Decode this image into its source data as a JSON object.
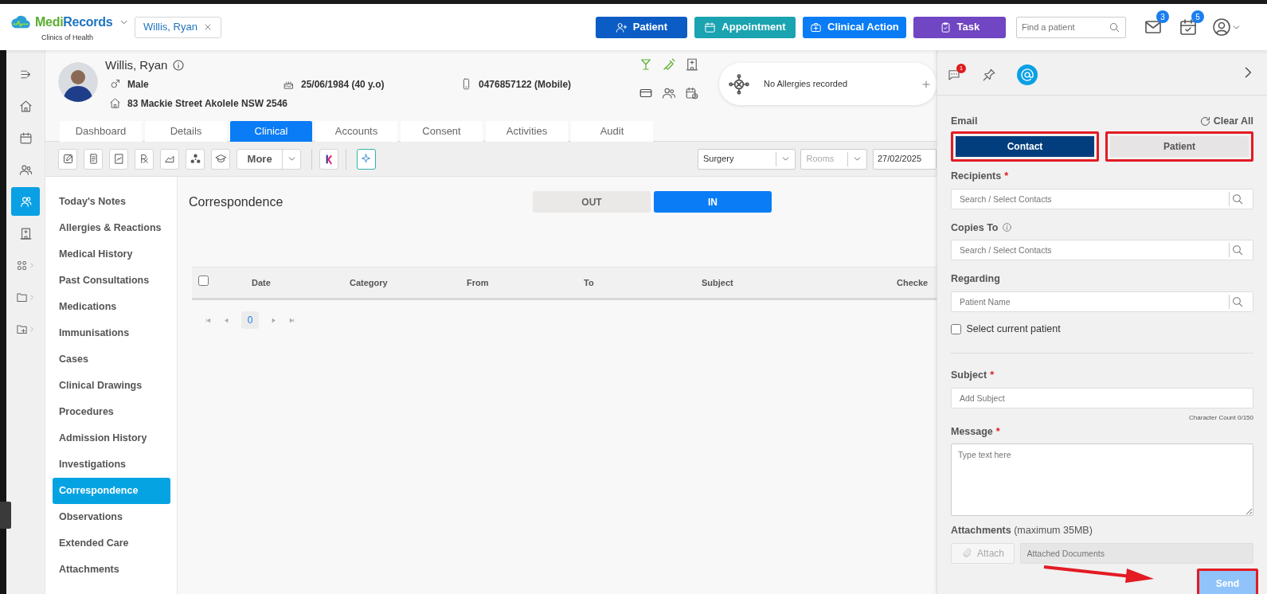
{
  "app": {
    "logo_parts": [
      {
        "text": "Medi",
        "color": "#5aae2e"
      },
      {
        "text": "Records",
        "color": "#1e73be"
      }
    ],
    "clinic": "Clinics of Health"
  },
  "open_patient": {
    "label": "Willis, Ryan"
  },
  "actions": [
    {
      "label": "Patient",
      "kind": "user-plus",
      "color": "#0b5cc4"
    },
    {
      "label": "Appointment",
      "kind": "calendar",
      "color": "#1aa3b0"
    },
    {
      "label": "Clinical Action",
      "kind": "medkit",
      "color": "#0a7cf5"
    },
    {
      "label": "Task",
      "kind": "clipboard",
      "color": "#7046c2"
    }
  ],
  "search": {
    "placeholder": "Find a patient"
  },
  "notifications": [
    {
      "kind": "mail",
      "count": "3"
    },
    {
      "kind": "calendar-check",
      "count": "5"
    }
  ],
  "rail": [
    {
      "kind": "expand",
      "selected": false,
      "submenu": false
    },
    {
      "kind": "home",
      "selected": false,
      "submenu": false
    },
    {
      "kind": "calendar",
      "selected": false,
      "submenu": false
    },
    {
      "kind": "people",
      "selected": false,
      "submenu": false
    },
    {
      "kind": "contacts",
      "selected": true,
      "submenu": false
    },
    {
      "kind": "hospital",
      "selected": false,
      "submenu": false
    },
    {
      "kind": "groups",
      "selected": false,
      "submenu": true
    },
    {
      "kind": "folder",
      "selected": false,
      "submenu": true
    },
    {
      "kind": "folder-plus",
      "selected": false,
      "submenu": true
    }
  ],
  "patient": {
    "name": "Willis, Ryan",
    "gender": "Male",
    "dob": "25/06/1984 (40 y.o)",
    "phone": "0476857122 (Mobile)",
    "address": "83 Mackie Street Akolele NSW 2546"
  },
  "allergies": {
    "text": "No Allergies recorded"
  },
  "tabs": [
    {
      "label": "Dashboard",
      "selected": false
    },
    {
      "label": "Details",
      "selected": false
    },
    {
      "label": "Clinical",
      "selected": true
    },
    {
      "label": "Accounts",
      "selected": false
    },
    {
      "label": "Consent",
      "selected": false
    },
    {
      "label": "Activities",
      "selected": false
    },
    {
      "label": "Audit",
      "selected": false
    }
  ],
  "toolbar": {
    "more": "More",
    "location": "Surgery",
    "rooms_placeholder": "Rooms",
    "date": "27/02/2025"
  },
  "side_menu": [
    {
      "label": "Today's Notes",
      "selected": false
    },
    {
      "label": "Allergies & Reactions",
      "selected": false
    },
    {
      "label": "Medical History",
      "selected": false
    },
    {
      "label": "Past Consultations",
      "selected": false
    },
    {
      "label": "Medications",
      "selected": false
    },
    {
      "label": "Immunisations",
      "selected": false
    },
    {
      "label": "Cases",
      "selected": false
    },
    {
      "label": "Clinical Drawings",
      "selected": false
    },
    {
      "label": "Procedures",
      "selected": false
    },
    {
      "label": "Admission History",
      "selected": false
    },
    {
      "label": "Investigations",
      "selected": false
    },
    {
      "label": "Correspondence",
      "selected": true
    },
    {
      "label": "Observations",
      "selected": false
    },
    {
      "label": "Extended Care",
      "selected": false
    },
    {
      "label": "Attachments",
      "selected": false
    }
  ],
  "content": {
    "title": "Correspondence",
    "direction": [
      {
        "label": "OUT",
        "selected": false
      },
      {
        "label": "IN",
        "selected": true
      }
    ],
    "columns": [
      "Date",
      "Category",
      "From",
      "To",
      "Subject",
      "Checke"
    ],
    "select_all": {
      "checked": false
    },
    "page": "0"
  },
  "panel": {
    "tabs": [
      {
        "kind": "chat",
        "badge": "1",
        "selected": false
      },
      {
        "kind": "pin",
        "selected": false
      },
      {
        "kind": "email",
        "selected": true
      }
    ],
    "section": "Email",
    "clear": "Clear All",
    "modes": [
      {
        "label": "Contact",
        "selected": true,
        "highlighted": true
      },
      {
        "label": "Patient",
        "selected": false,
        "highlighted": true
      }
    ],
    "fields": [
      {
        "label": "Recipients",
        "required_mark": "*",
        "info": false,
        "placeholder": "Search / Select Contacts"
      },
      {
        "label": "Copies To",
        "info": true,
        "placeholder": "Search / Select Contacts"
      },
      {
        "label": "Regarding",
        "info": false,
        "placeholder": "Patient Name"
      }
    ],
    "current_patient": {
      "label": "Select current patient",
      "checked": false
    },
    "subject": {
      "label": "Subject",
      "required_mark": "*",
      "placeholder": "Add Subject"
    },
    "char_count": "Character Count 0/150",
    "message": {
      "label": "Message",
      "required_mark": "*",
      "placeholder": "Type text here"
    },
    "attachments": {
      "label": "**Attachments** (maximum 35MB)",
      "attach": "Attach",
      "docs_placeholder": "Attached Documents"
    },
    "send": {
      "label": "Send",
      "disabled": true,
      "highlighted": true
    }
  }
}
